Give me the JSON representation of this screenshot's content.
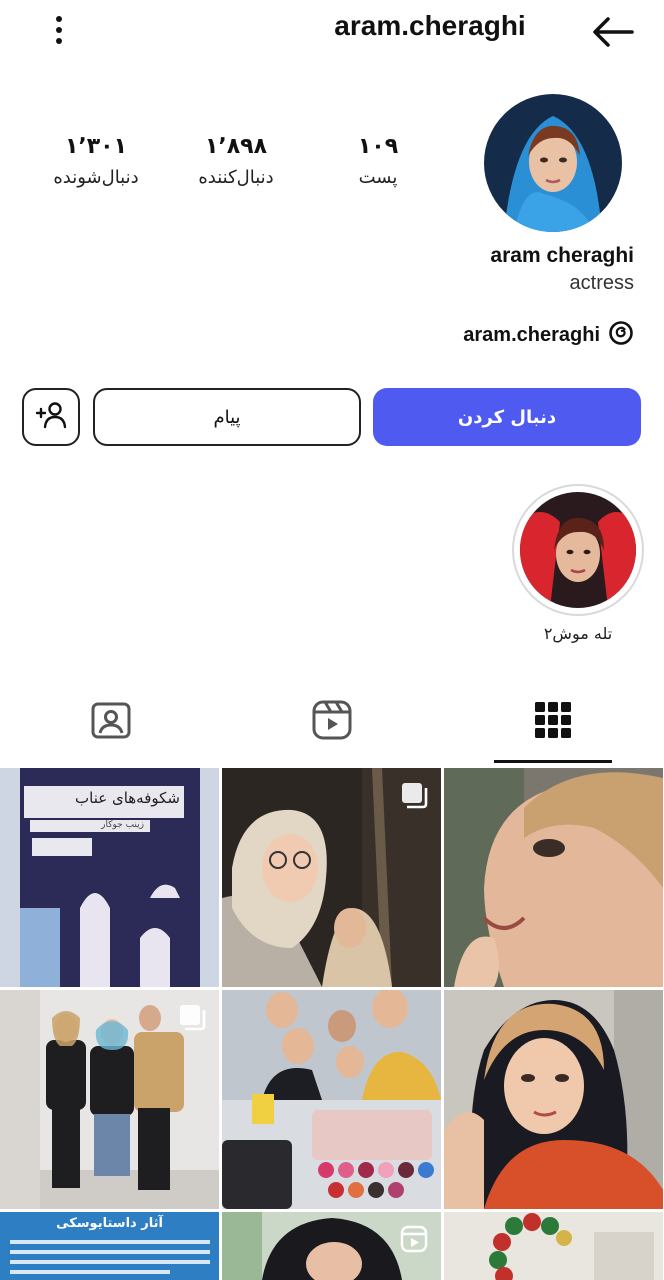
{
  "header": {
    "username": "aram.cheraghi"
  },
  "stats": {
    "posts_value": "۱۰۹",
    "posts_label": "پست",
    "followers_value": "۱٬۸۹۸",
    "followers_label": "دنبال‌کننده",
    "following_value": "۱٬۳۰۱",
    "following_label": "دنبال‌شونده"
  },
  "profile": {
    "full_name": "aram cheraghi",
    "bio": "actress",
    "threads_handle": "aram.cheraghi"
  },
  "actions": {
    "follow_label": "دنبال کردن",
    "message_label": "پیام"
  },
  "highlights": [
    {
      "label": "تله موش۲"
    }
  ],
  "grid": {
    "posts": [
      {
        "text_line1": "شکوفه‌های عناب",
        "text_line2": "زینب جوکار"
      },
      {
        "multi": true
      },
      {
        "multi": false
      },
      {
        "multi": true
      },
      {
        "multi": false
      },
      {
        "multi": false
      },
      {
        "text_line1": "آثار داستایوسکی"
      },
      {
        "reel": true
      },
      {
        "multi": false
      }
    ]
  },
  "colors": {
    "accent": "#4f5bf0",
    "text": "#111111",
    "border": "#222222"
  }
}
